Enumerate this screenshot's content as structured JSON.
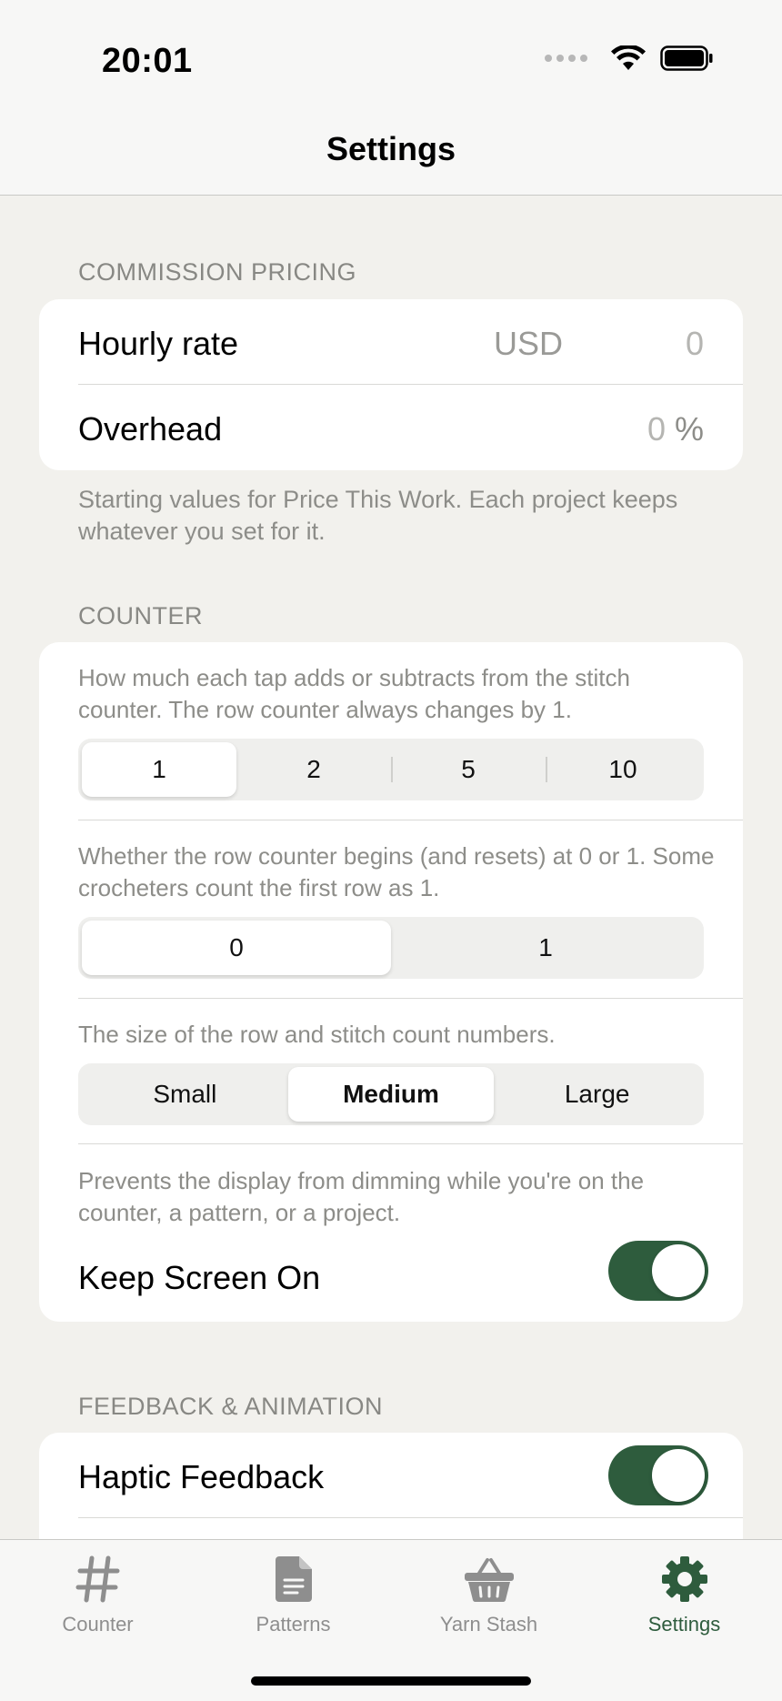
{
  "status_bar": {
    "time": "20:01"
  },
  "nav": {
    "title": "Settings"
  },
  "commission": {
    "header": "COMMISSION PRICING",
    "hourly_label": "Hourly rate",
    "hourly_currency": "USD",
    "hourly_value": "0",
    "overhead_label": "Overhead",
    "overhead_value": "0",
    "overhead_unit": "%",
    "footer": "Starting values for Price This Work. Each project keeps whatever you set for it."
  },
  "counter": {
    "header": "COUNTER",
    "step_desc": "How much each tap adds or subtracts from the stitch counter. The row counter always changes by 1.",
    "step_options": [
      "1",
      "2",
      "5",
      "10"
    ],
    "step_selected": "1",
    "start_desc": "Whether the row counter begins (and resets) at 0 or 1. Some crocheters count the first row as 1.",
    "start_options": [
      "0",
      "1"
    ],
    "start_selected": "0",
    "size_desc": "The size of the row and stitch count numbers.",
    "size_options": [
      "Small",
      "Medium",
      "Large"
    ],
    "size_selected": "Medium",
    "screen_desc": "Prevents the display from dimming while you're on the counter, a pattern, or a project.",
    "keep_screen_label": "Keep Screen On",
    "keep_screen_on": true
  },
  "feedback": {
    "header": "FEEDBACK & ANIMATION",
    "haptic_label": "Haptic Feedback",
    "haptic_on": true
  },
  "tabs": [
    {
      "label": "Counter",
      "icon": "hash-icon",
      "active": false
    },
    {
      "label": "Patterns",
      "icon": "document-icon",
      "active": false
    },
    {
      "label": "Yarn Stash",
      "icon": "basket-icon",
      "active": false
    },
    {
      "label": "Settings",
      "icon": "gear-icon",
      "active": true
    }
  ],
  "colors": {
    "accent": "#2e5c3d",
    "background": "#f2f1ed",
    "secondary_text": "#8d8d89"
  }
}
